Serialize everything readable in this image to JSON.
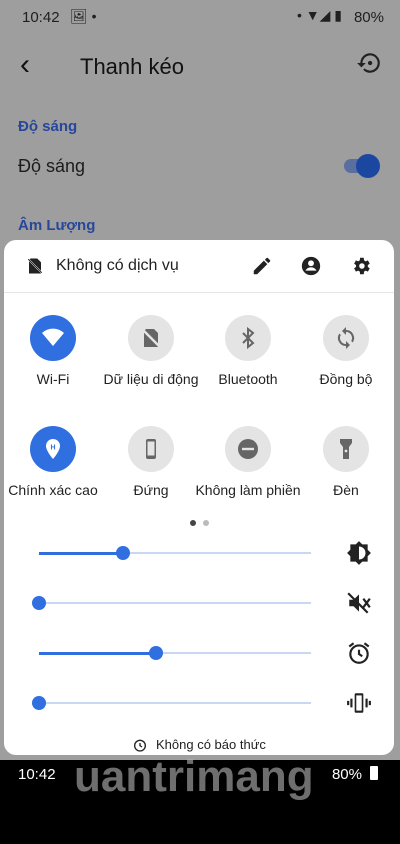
{
  "status_bar": {
    "time": "10:42",
    "battery": "80%"
  },
  "app": {
    "title": "Thanh kéo",
    "section_brightness": "Độ sáng",
    "row_brightness": "Độ sáng",
    "section_volume": "Âm Lượng"
  },
  "panel": {
    "header_text": "Không có dịch vụ",
    "tiles": [
      {
        "label": "Wi-Fi",
        "icon": "wifi-icon",
        "active": true
      },
      {
        "label": "Dữ liệu di động",
        "icon": "mobile-data-off-icon",
        "active": false
      },
      {
        "label": "Bluetooth",
        "icon": "bluetooth-icon",
        "active": false
      },
      {
        "label": "Đồng bộ",
        "icon": "sync-icon",
        "active": false
      },
      {
        "label": "Chính xác cao",
        "icon": "location-icon",
        "active": true
      },
      {
        "label": "Đứng",
        "icon": "portrait-icon",
        "active": false
      },
      {
        "label": "Không làm phiền",
        "icon": "do-not-disturb-icon",
        "active": false
      },
      {
        "label": "Đèn",
        "icon": "flashlight-icon",
        "active": false
      }
    ],
    "page_dots": {
      "count": 2,
      "active": 0
    },
    "sliders": [
      {
        "name": "brightness",
        "value": 0.31,
        "icon": "brightness-icon"
      },
      {
        "name": "media-volume",
        "value": 0.0,
        "icon": "volume-off-icon"
      },
      {
        "name": "alarm-volume",
        "value": 0.43,
        "icon": "alarm-icon"
      },
      {
        "name": "ring-volume",
        "value": 0.0,
        "icon": "vibrate-icon"
      }
    ],
    "alarm_text": "Không có báo thức"
  },
  "bottom_bar": {
    "time": "10:42",
    "battery": "80%"
  },
  "watermark": "uantrimang",
  "colors": {
    "accent": "#2f6fe0",
    "inactive_tile": "#e4e4e4"
  }
}
